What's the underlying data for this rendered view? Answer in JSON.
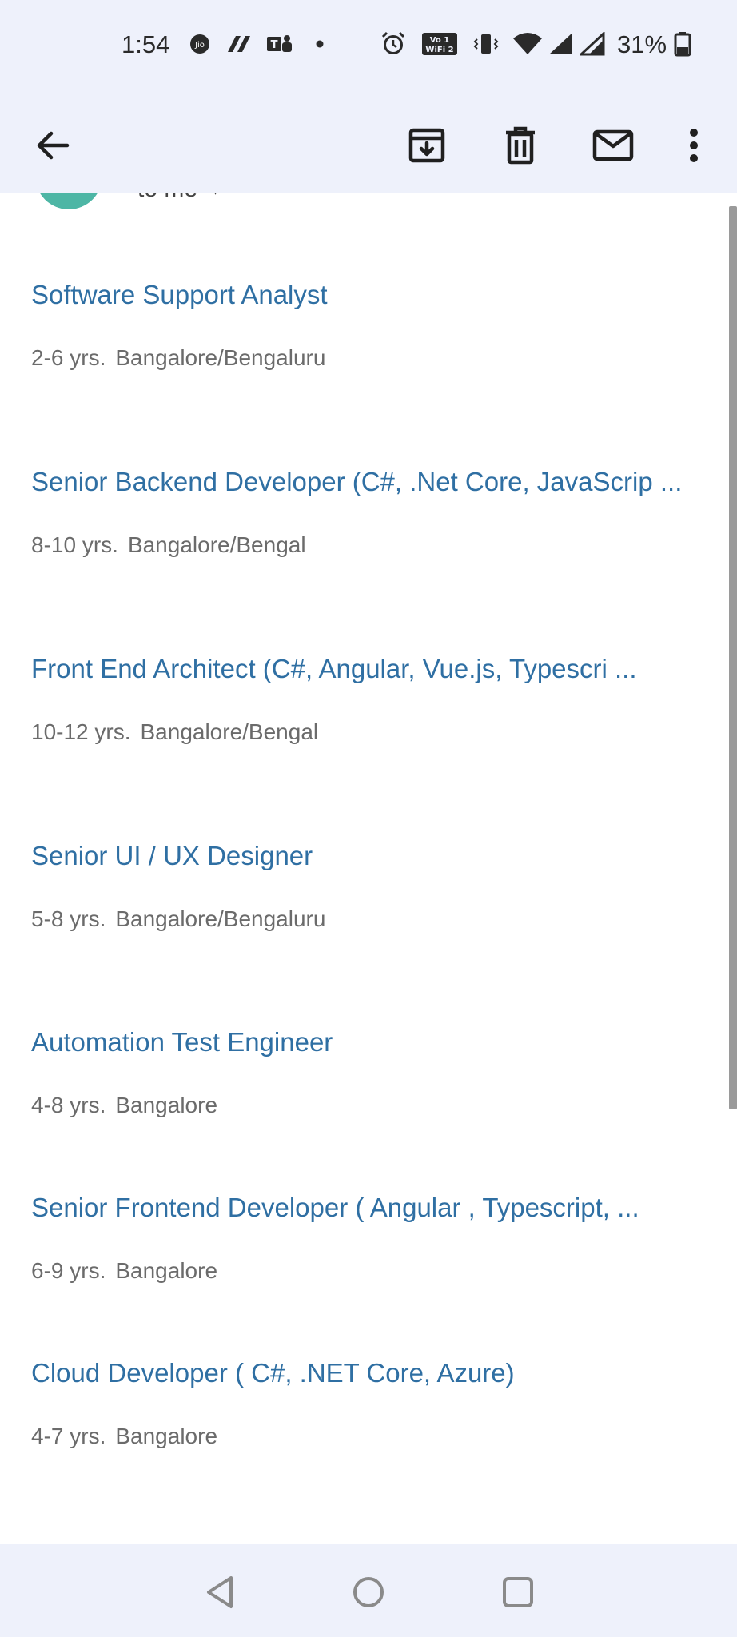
{
  "status_bar": {
    "time": "1:54",
    "battery_percent": "31%",
    "icons": [
      "jio-icon",
      "app-icon",
      "teams-icon",
      "dot-icon",
      "alarm-icon",
      "vowifi-icon",
      "vibrate-icon",
      "wifi-icon",
      "signal-icon",
      "signal-icon-2",
      "battery-icon"
    ]
  },
  "app_bar": {
    "icons": [
      "back-arrow-icon",
      "archive-icon",
      "delete-icon",
      "mail-icon",
      "more-vert-icon"
    ]
  },
  "email_header": {
    "recipient_text": "to me"
  },
  "jobs": [
    {
      "title": "Software Support Analyst",
      "experience": "2-6 yrs.",
      "location": "Bangalore/Bengaluru"
    },
    {
      "title": "Senior Backend Developer (C#, .Net Core, JavaScrip ...",
      "experience": "8-10 yrs.",
      "location": "Bangalore/Bengal"
    },
    {
      "title": "Front End Architect (C#, Angular, Vue.js, Typescri ...",
      "experience": "10-12 yrs.",
      "location": "Bangalore/Bengal"
    },
    {
      "title": "Senior UI / UX Designer",
      "experience": "5-8 yrs.",
      "location": "Bangalore/Bengaluru"
    },
    {
      "title": "Automation Test Engineer",
      "experience": "4-8 yrs.",
      "location": "Bangalore"
    },
    {
      "title": "Senior Frontend Developer ( Angular , Typescript, ...",
      "experience": "6-9 yrs.",
      "location": "Bangalore"
    },
    {
      "title": "Cloud Developer ( C#, .NET Core, Azure)",
      "experience": "4-7 yrs.",
      "location": "Bangalore"
    }
  ],
  "nav_bar": {
    "icons": [
      "back-triangle-icon",
      "home-circle-icon",
      "recents-square-icon"
    ]
  },
  "colors": {
    "bar_background": "#eef1fb",
    "link_blue": "#2f6fa3",
    "meta_gray": "#6b6b6b",
    "avatar_teal": "#4db6a5"
  }
}
